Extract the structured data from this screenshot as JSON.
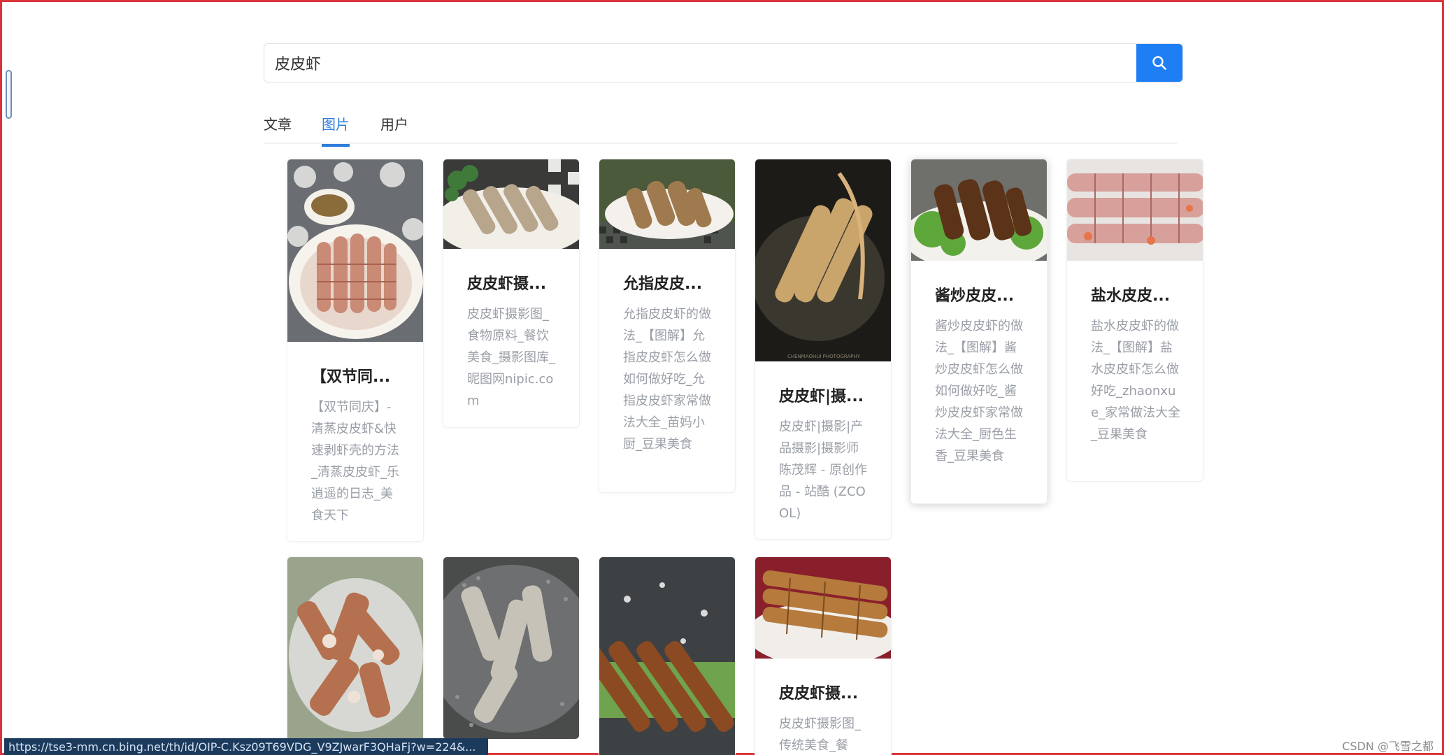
{
  "search": {
    "query": "皮皮虾",
    "button_icon": "search-icon",
    "button_color": "#1e7ef3"
  },
  "tabs": [
    {
      "label": "文章",
      "active": false
    },
    {
      "label": "图片",
      "active": true
    },
    {
      "label": "用户",
      "active": false
    }
  ],
  "accent_color": "#2f7ddb",
  "results": [
    {
      "title": "【双节同...",
      "desc": "【双节同庆】-清蒸皮皮虾&快速剥虾壳的方法_清蒸皮皮虾_乐逍遥的日志_美食天下"
    },
    {
      "title": "皮皮虾摄...",
      "desc": "皮皮虾摄影图_食物原料_餐饮美食_摄影图库_昵图网nipic.com"
    },
    {
      "title": "允指皮皮...",
      "desc": "允指皮皮虾的做法_【图解】允指皮皮虾怎么做如何做好吃_允指皮皮虾家常做法大全_苗妈小厨_豆果美食"
    },
    {
      "title": "皮皮虾|摄...",
      "desc": "皮皮虾|摄影|产品摄影|摄影师陈茂辉 - 原创作品 - 站酷 (ZCOOL)"
    },
    {
      "title": "酱炒皮皮...",
      "desc": "酱炒皮皮虾的做法_【图解】酱炒皮皮虾怎么做如何做好吃_酱炒皮皮虾家常做法大全_厨色生香_豆果美食"
    },
    {
      "title": "盐水皮皮...",
      "desc": "盐水皮皮虾的做法_【图解】盐水皮皮虾怎么做好吃_zhaonxue_家常做法大全_豆果美食"
    },
    {
      "title": "",
      "desc": ""
    },
    {
      "title": "",
      "desc": ""
    },
    {
      "title": "",
      "desc": ""
    },
    {
      "title": "皮皮虾摄...",
      "desc": "皮皮虾摄影图_传统美食_餐"
    }
  ],
  "status_bar": {
    "url": "https://tse3-mm.cn.bing.net/th/id/OIP-C.Ksz09T69VDG_V9ZJwarF3QHaFj?w=224&..."
  },
  "watermark": "CSDN @飞雪之都"
}
